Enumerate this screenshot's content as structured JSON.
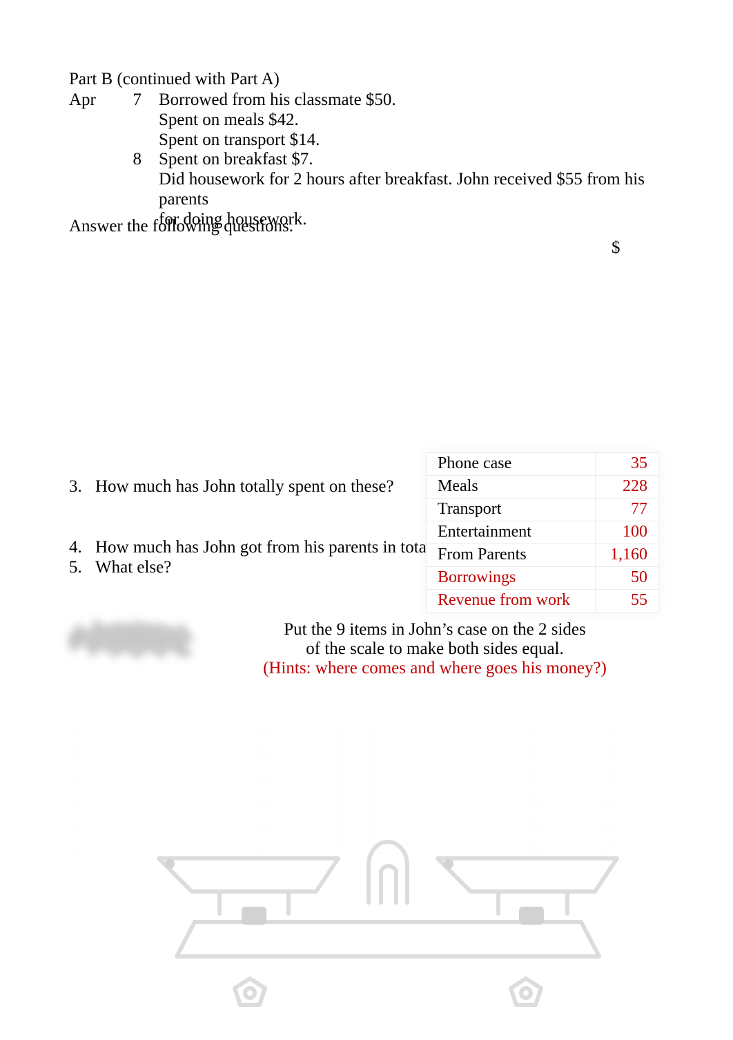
{
  "document": {
    "part_heading": "Part B (continued with Part A)",
    "journal": {
      "month": "Apr",
      "entries": [
        {
          "day": "7",
          "lines": [
            "Borrowed from his classmate $50.",
            "Spent on meals $42.",
            "Spent on transport $14."
          ]
        },
        {
          "day": "8",
          "lines": [
            "Spent on breakfast $7.",
            "Did housework for 2 hours after breakfast. John received $55 from his parents",
            "for doing housework."
          ]
        }
      ]
    },
    "answer_prompt": "Answer the following questions.",
    "currency_symbol": "$",
    "questions": [
      {
        "number": "3.",
        "text": "How much has John totally spent on these?"
      },
      {
        "number": "4.",
        "text": "How much has John got from his parents in total?"
      },
      {
        "number": "5.",
        "text": "What else?"
      }
    ],
    "items_table": {
      "rows": [
        {
          "name": "Phone case",
          "value": "35",
          "name_color": "#000000"
        },
        {
          "name": "Meals",
          "value": "228",
          "name_color": "#000000"
        },
        {
          "name": "Transport",
          "value": "77",
          "name_color": "#000000"
        },
        {
          "name": "Entertainment",
          "value": "100",
          "name_color": "#000000"
        },
        {
          "name": "From Parents",
          "value": "1,160",
          "name_color": "#000000"
        },
        {
          "name": "Borrowings",
          "value": "50",
          "name_color": "#C00000"
        },
        {
          "name": "Revenue from work",
          "value": "55",
          "name_color": "#C00000"
        }
      ]
    },
    "instruction": {
      "line1": "Put the 9 items in John’s case on the 2 sides",
      "line2": "of the scale to make both sides equal.",
      "hint": "(Hints: where comes and where goes his money?)"
    },
    "colors": {
      "red": "#C00000",
      "text": "#000000",
      "scale_stroke": "#dcdcdc",
      "table_grid": "#ececec"
    }
  }
}
